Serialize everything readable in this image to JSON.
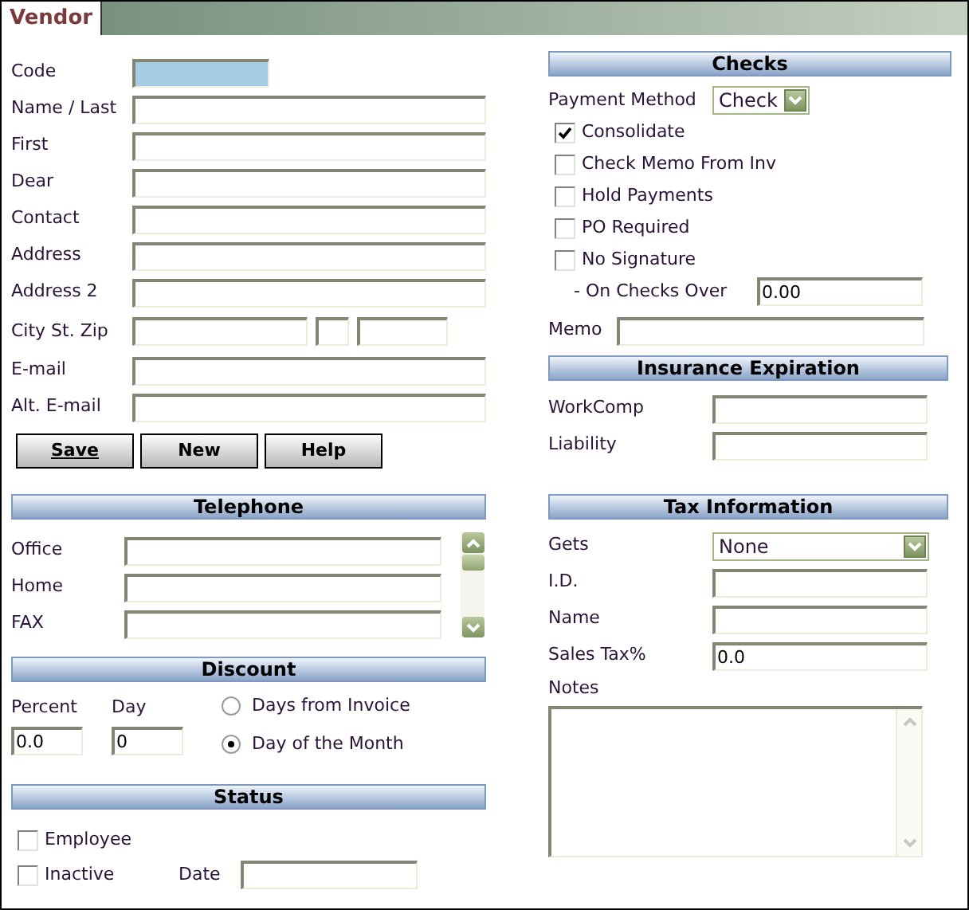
{
  "tab": {
    "label": "Vendor",
    "selected": true
  },
  "vendor_fields": [
    {
      "kind": "code",
      "label": "Code"
    },
    {
      "kind": "text",
      "label": "Name / Last"
    },
    {
      "kind": "text",
      "label": "First"
    },
    {
      "kind": "text",
      "label": "Dear"
    },
    {
      "kind": "text",
      "label": "Contact"
    },
    {
      "kind": "text",
      "label": "Address"
    },
    {
      "kind": "text",
      "label": "Address 2"
    },
    {
      "kind": "city_st_zip",
      "label": "City St. Zip"
    },
    {
      "kind": "text",
      "label": "E-mail"
    },
    {
      "kind": "text",
      "label": "Alt. E-mail"
    }
  ],
  "buttons": [
    {
      "label": "Save",
      "mnemonic": true
    },
    {
      "label": "New",
      "mnemonic": false
    },
    {
      "label": "Help",
      "mnemonic": false
    }
  ],
  "telephone": {
    "title": "Telephone",
    "fields": [
      {
        "label": "Office"
      },
      {
        "label": "Home"
      },
      {
        "label": "FAX"
      }
    ]
  },
  "discount": {
    "title": "Discount",
    "percent": {
      "label": "Percent",
      "value": "0.0"
    },
    "day": {
      "label": "Day",
      "value": "0"
    },
    "options": [
      {
        "label": "Days from Invoice",
        "selected": false
      },
      {
        "label": "Day of the Month",
        "selected": true
      }
    ]
  },
  "status": {
    "title": "Status",
    "checkboxes": [
      {
        "label": "Employee",
        "checked": false
      },
      {
        "label": "Inactive",
        "checked": false
      }
    ],
    "date": {
      "label": "Date"
    }
  },
  "checks": {
    "title": "Checks",
    "payment_method": {
      "label": "Payment Method",
      "value": "Check"
    },
    "options": [
      {
        "label": "Consolidate",
        "checked": true
      },
      {
        "label": "Check Memo From Inv",
        "checked": false
      },
      {
        "label": "Hold Payments",
        "checked": false
      },
      {
        "label": "PO Required",
        "checked": false
      },
      {
        "label": "No Signature",
        "checked": false
      }
    ],
    "checks_over": {
      "label": "- On Checks Over",
      "value": "0.00"
    },
    "memo": {
      "label": "Memo"
    }
  },
  "insurance": {
    "title": "Insurance Expiration",
    "fields": [
      {
        "label": "WorkComp"
      },
      {
        "label": "Liability"
      }
    ]
  },
  "tax": {
    "title": "Tax Information",
    "gets": {
      "label": "Gets",
      "value": "None"
    },
    "fields": [
      {
        "label": "I.D."
      },
      {
        "label": "Name"
      },
      {
        "label": "Sales Tax%",
        "value": "0.0"
      }
    ],
    "notes": {
      "label": "Notes"
    }
  }
}
